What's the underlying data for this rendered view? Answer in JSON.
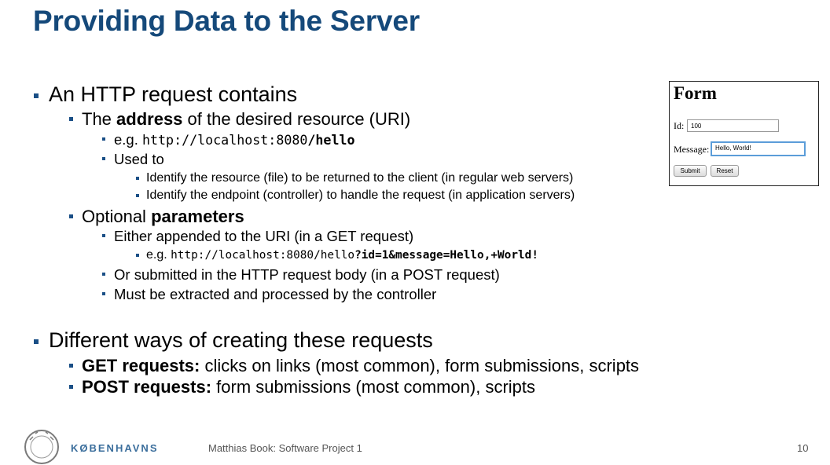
{
  "slide": {
    "title": "Providing Data to the Server",
    "bullets": {
      "b1": "An HTTP request contains",
      "b1_1_pre": "The ",
      "b1_1_bold": "address",
      "b1_1_post": " of the desired resource (URI)",
      "b1_1_1_pre": "e.g. ",
      "b1_1_1_code": "http://localhost:8080",
      "b1_1_1_code_bold": "/hello",
      "b1_1_2": "Used to",
      "b1_1_2_1": "Identify the resource (file) to be returned to the client (in regular web servers)",
      "b1_1_2_2": "Identify the endpoint (controller) to handle the request (in application servers)",
      "b1_2_pre": "Optional ",
      "b1_2_bold": "parameters",
      "b1_2_1": "Either appended to the URI (in a GET request)",
      "b1_2_1_1_pre": "e.g. ",
      "b1_2_1_1_code": "http://localhost:8080/hello",
      "b1_2_1_1_code_bold": "?id=1&message=Hello,+World!",
      "b1_2_2": "Or submitted in the HTTP request body (in a POST request)",
      "b1_2_3": "Must be extracted and processed by the controller",
      "b2": "Different ways of creating these requests",
      "b2_1_bold": "GET requests:",
      "b2_1_post": " clicks on links (most common), form submissions, scripts",
      "b2_2_bold": "POST requests:",
      "b2_2_post": " form submissions (most common), scripts"
    }
  },
  "form_example": {
    "title": "Form",
    "id_label": "Id:",
    "id_value": "100",
    "message_label": "Message:",
    "message_value": "Hello, World!",
    "submit_label": "Submit",
    "reset_label": "Reset"
  },
  "footer": {
    "organization": "KØBENHAVNS",
    "author": "Matthias Book: Software Project 1",
    "page": "10"
  },
  "colors": {
    "title": "#15497a",
    "bullet": "#1a4f86"
  }
}
